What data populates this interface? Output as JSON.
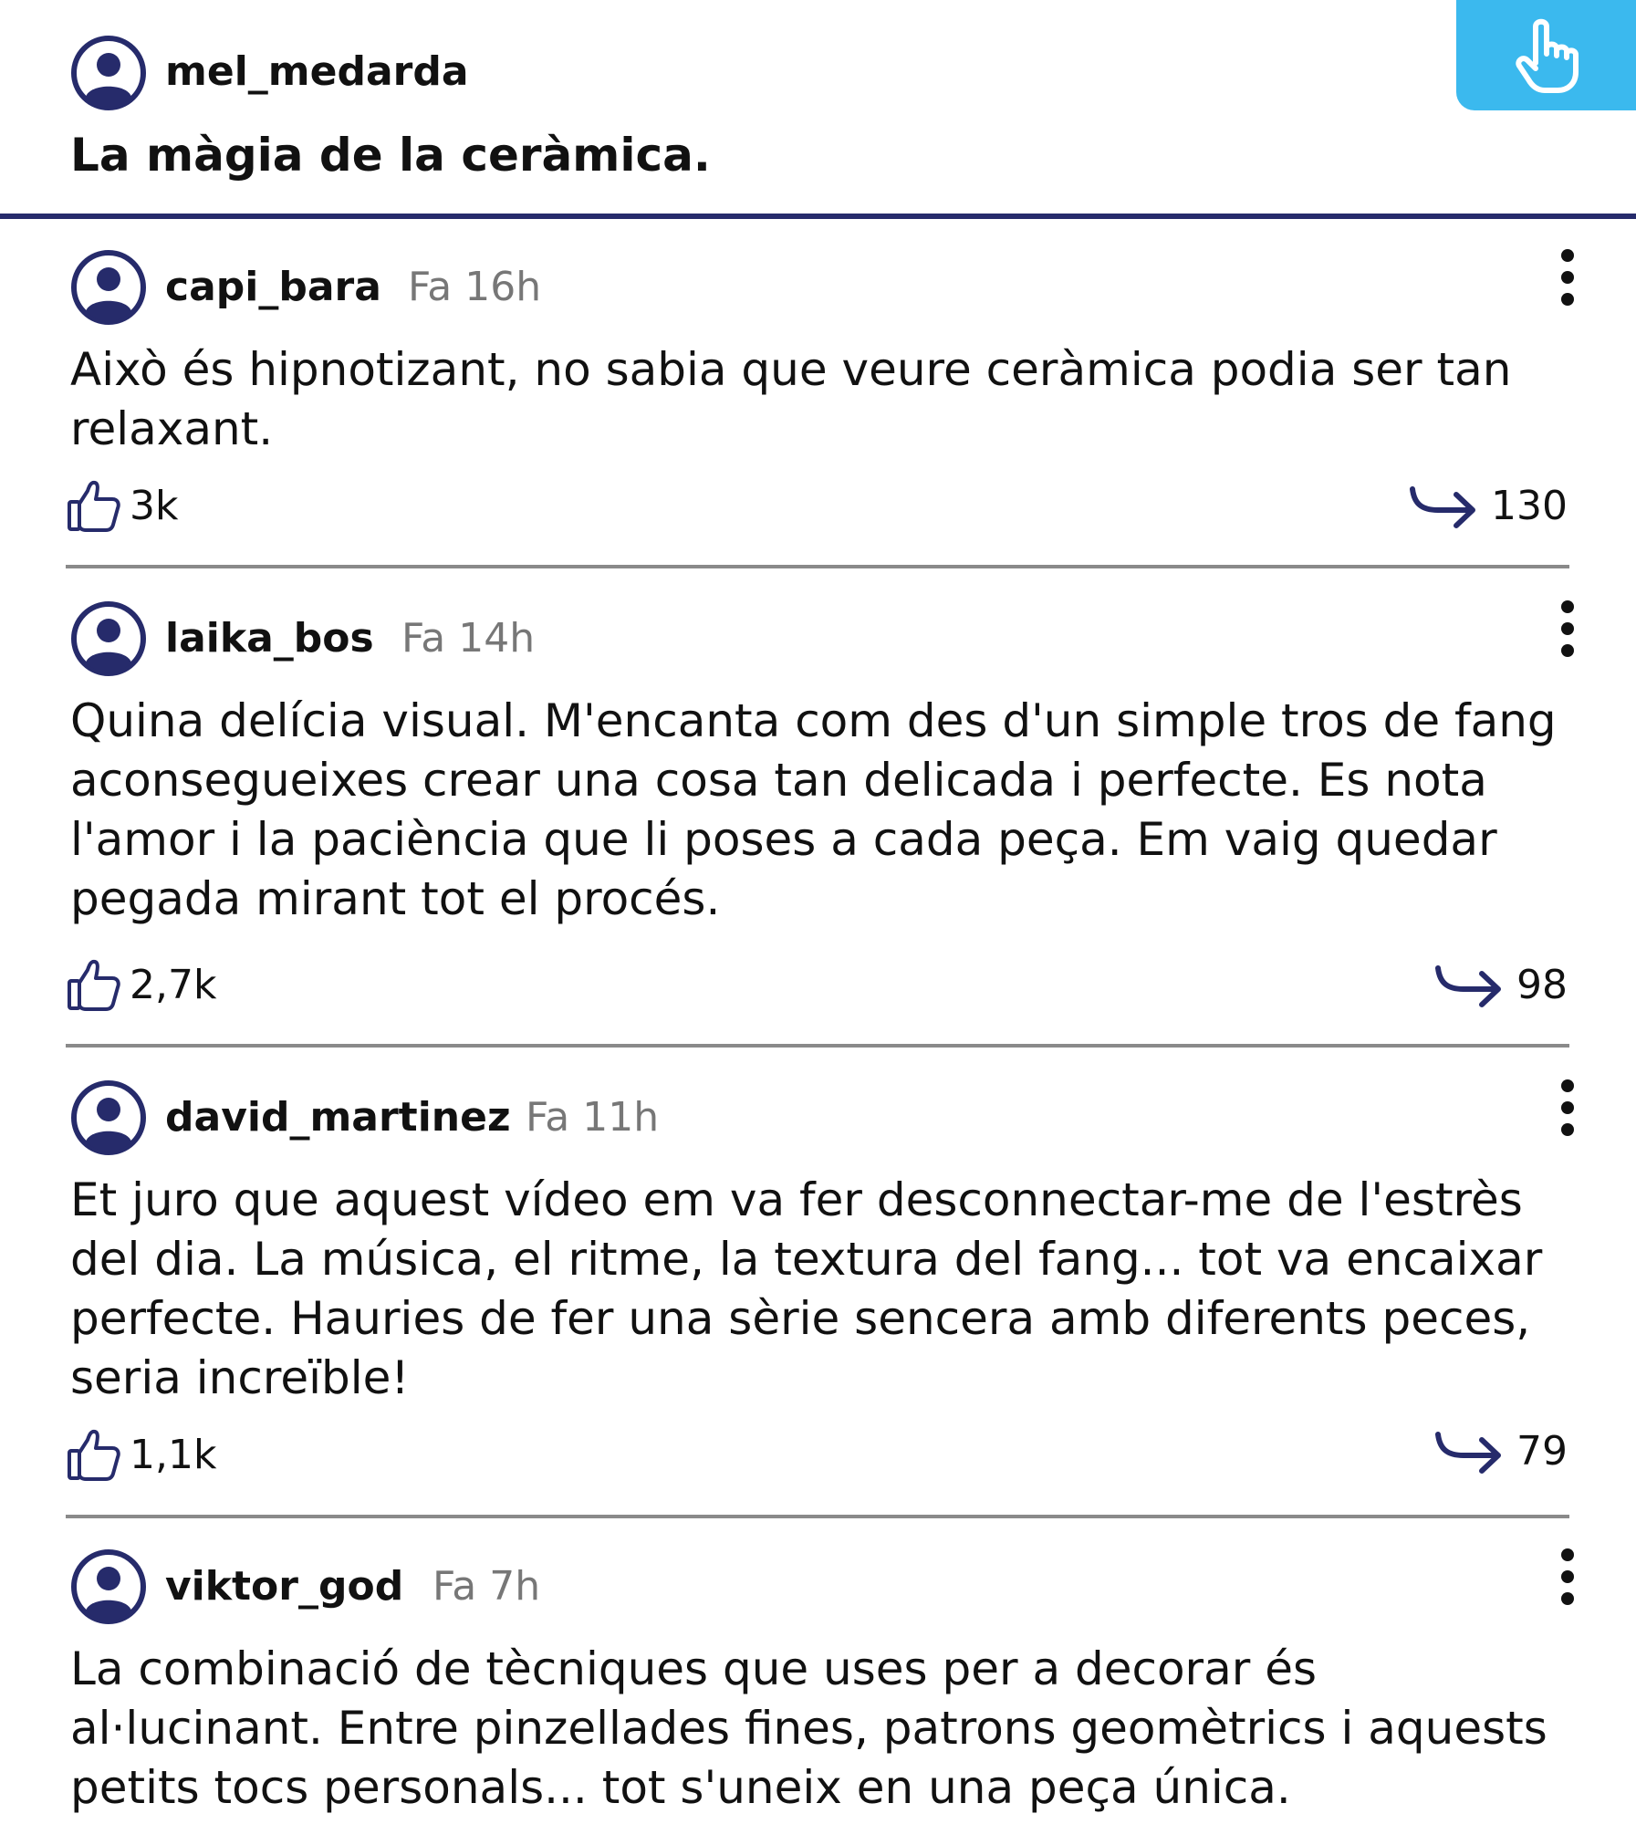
{
  "colors": {
    "accent_navy": "#262b6b",
    "tap_button_bg": "#3bb9ee",
    "divider_gray": "#8a8a8a",
    "timestamp_gray": "#777777",
    "text": "#111111"
  },
  "post": {
    "author": "mel_medarda",
    "title": "La màgia de la ceràmica.",
    "avatar_icon": "user-avatar-icon",
    "tap_icon": "pointing-hand-icon"
  },
  "comments": [
    {
      "username": "capi_bara",
      "timestamp": "Fa 16h",
      "text": "Això és hipnotizant, no sabia que veure ceràmica podia ser tan relaxant.",
      "likes": "3k",
      "replies": "130"
    },
    {
      "username": "laika_bos",
      "timestamp": "Fa 14h",
      "text": "Quina delícia visual. M'encanta com des d'un simple tros de fang aconsegueixes crear una cosa tan delicada i perfecte. Es nota l'amor i la paciència que li poses a cada peça. Em vaig quedar pegada mirant tot el procés.",
      "likes": "2,7k",
      "replies": "98"
    },
    {
      "username": "david_martinez",
      "timestamp": "Fa 11h",
      "text": "Et juro que aquest vídeo em va fer desconnectar-me de l'estrès del dia. La música, el ritme, la textura del fang... tot va encaixar perfecte. Hauries de fer una sèrie sencera amb diferents peces, seria increïble!",
      "likes": "1,1k",
      "replies": "79"
    },
    {
      "username": "viktor_god",
      "timestamp": "Fa 7h",
      "text": "La combinació de tècniques que uses per a decorar és al·lucinant. Entre pinzellades fines, patrons geomètrics i aquests petits tocs personals... tot s'uneix en una peça única.",
      "likes": "",
      "replies": ""
    }
  ],
  "icons": {
    "like": "thumbs-up-icon",
    "reply": "reply-arrow-icon",
    "more": "more-options-icon"
  }
}
